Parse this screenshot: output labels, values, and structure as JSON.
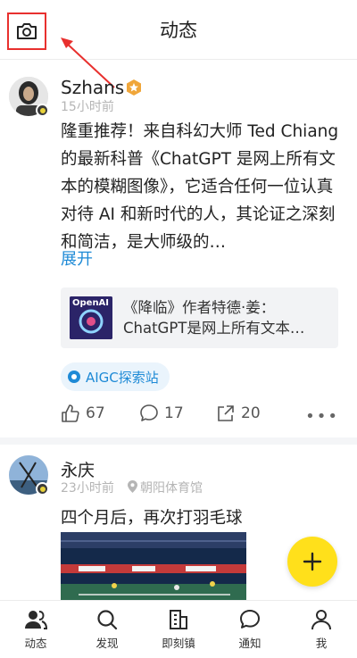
{
  "header": {
    "title": "动态"
  },
  "post1": {
    "user_name": "Szhans",
    "time": "15小时前",
    "text": "隆重推荐！来自科幻大师 Ted Chiang 的最新科普《ChatGPT 是网上所有文本的模糊图像》，它适合任何一位认真对待 AI 和新时代的人，其论证之深刻和简洁，是大师级的…",
    "expand_label": "展开",
    "link_card": {
      "title": "《降临》作者特德·姜：ChatGPT是网上所有文本…",
      "thumb_text": "OpenAI"
    },
    "topic": "AIGC探索站",
    "likes": "67",
    "comments": "17",
    "shares": "20"
  },
  "post2": {
    "user_name": "永庆",
    "time": "23小时前",
    "location": "朝阳体育馆",
    "text": "四个月后，再次打羽毛球"
  },
  "fab": {
    "label": "+"
  },
  "tabs": [
    {
      "label": "动态",
      "icon": "user-group-icon"
    },
    {
      "label": "发现",
      "icon": "search-icon"
    },
    {
      "label": "即刻镇",
      "icon": "building-icon"
    },
    {
      "label": "通知",
      "icon": "chat-bubble-icon"
    },
    {
      "label": "我",
      "icon": "person-icon"
    }
  ],
  "colors": {
    "accent": "#1e8ad6",
    "fab": "#ffe01b",
    "highlight": "#e8302e"
  }
}
